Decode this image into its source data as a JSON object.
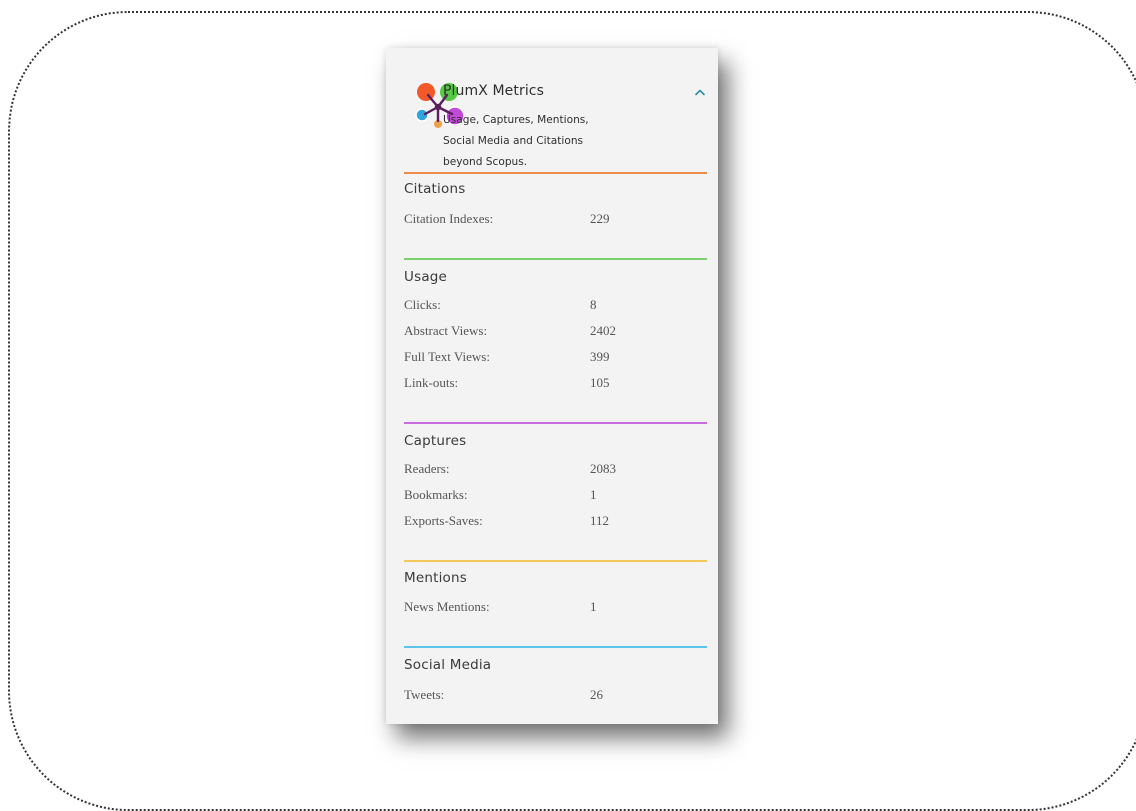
{
  "header": {
    "title": "PlumX Metrics",
    "subtitle_lines": [
      "Usage, Captures, Mentions,",
      "Social Media and Citations",
      "beyond Scopus."
    ],
    "collapse_icon": "chevron-up-icon",
    "logo_icon": "plumx-logo-icon"
  },
  "colors": {
    "citations": "#f08a4b",
    "usage": "#7bd16e",
    "captures": "#c86ae0",
    "mentions": "#f4c85a",
    "social_media": "#5bc4ea",
    "collapse_icon": "#2f8ea6"
  },
  "sections": {
    "citations": {
      "title": "Citations",
      "rows": [
        {
          "label": "Citation Indexes:",
          "value": "229"
        }
      ]
    },
    "usage": {
      "title": "Usage",
      "rows": [
        {
          "label": "Clicks:",
          "value": "8"
        },
        {
          "label": "Abstract Views:",
          "value": "2402"
        },
        {
          "label": "Full Text Views:",
          "value": "399"
        },
        {
          "label": "Link-outs:",
          "value": "105"
        }
      ]
    },
    "captures": {
      "title": "Captures",
      "rows": [
        {
          "label": "Readers:",
          "value": "2083"
        },
        {
          "label": "Bookmarks:",
          "value": "1"
        },
        {
          "label": "Exports-Saves:",
          "value": "112"
        }
      ]
    },
    "mentions": {
      "title": "Mentions",
      "rows": [
        {
          "label": "News Mentions:",
          "value": "1"
        }
      ]
    },
    "social_media": {
      "title": "Social Media",
      "rows": [
        {
          "label": "Tweets:",
          "value": "26"
        }
      ]
    }
  }
}
